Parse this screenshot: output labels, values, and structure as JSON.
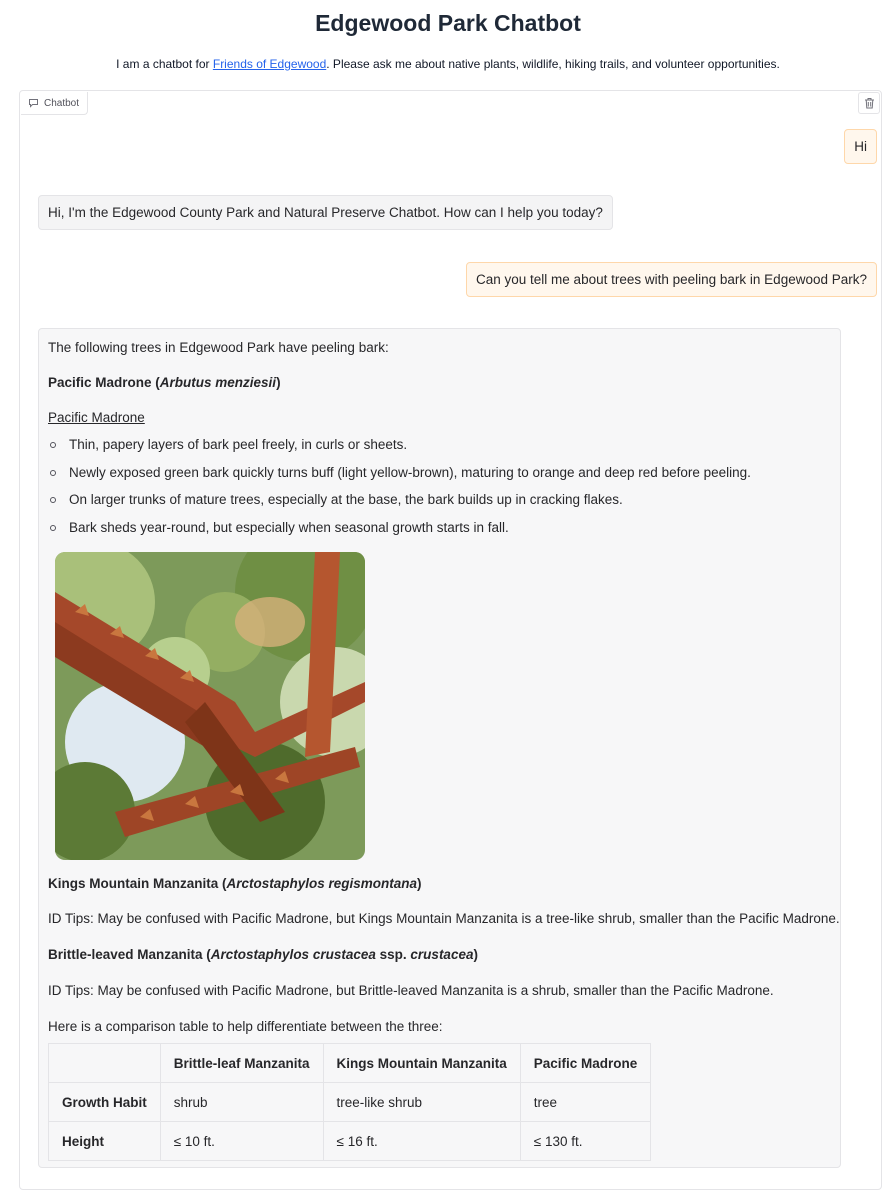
{
  "page": {
    "title": "Edgewood Park Chatbot",
    "subtitle_prefix": "I am a chatbot for ",
    "subtitle_link": "Friends of Edgewood",
    "subtitle_suffix": ". Please ask me about native plants, wildlife, hiking trails, and volunteer opportunities."
  },
  "chatbot": {
    "tab_label": "Chatbot",
    "icons": {
      "tab": "chat-icon",
      "clear": "trash-icon"
    }
  },
  "messages": [
    {
      "role": "user",
      "text": "Hi"
    },
    {
      "role": "bot",
      "text": "Hi, I'm the Edgewood County Park and Natural Preserve Chatbot. How can I help you today?"
    },
    {
      "role": "user",
      "text": "Can you tell me about trees with peeling bark in Edgewood Park?"
    }
  ],
  "answer": {
    "intro": "The following trees in Edgewood Park have peeling bark:",
    "madrone_name": "Pacific Madrone",
    "madrone_latin": "Arbutus menziesii",
    "madrone_link": "Pacific Madrone",
    "bullets": [
      "Thin, papery layers of bark peel freely, in curls or sheets.",
      "Newly exposed green bark quickly turns buff (light yellow-brown), maturing to orange and deep red before peeling.",
      "On larger trunks of mature trees, especially at the base, the bark builds up in cracking flakes.",
      "Bark sheds year-round, but especially when seasonal growth starts in fall."
    ],
    "kings_name": "Kings Mountain Manzanita",
    "kings_latin": "Arctostaphylos regismontana",
    "kings_tip": "ID Tips: May be confused with Pacific Madrone, but Kings Mountain Manzanita is a tree-like shrub, smaller than the Pacific Madrone.",
    "brittle_name": "Brittle-leaved Manzanita",
    "brittle_latin": "Arctostaphylos crustacea",
    "brittle_ssp": "ssp.",
    "brittle_latin2": "crustacea",
    "brittle_tip": "ID Tips: May be confused with Pacific Madrone, but Brittle-leaved Manzanita is a shrub, smaller than the Pacific Madrone.",
    "table_intro": "Here is a comparison table to help differentiate between the three:",
    "table": {
      "headers": [
        "",
        "Brittle-leaf Manzanita",
        "Kings Mountain Manzanita",
        "Pacific Madrone"
      ],
      "rows": [
        [
          "Growth Habit",
          "shrub",
          "tree-like shrub",
          "tree"
        ],
        [
          "Height",
          "≤ 10 ft.",
          "≤ 16 ft.",
          "≤ 130 ft."
        ]
      ]
    }
  }
}
